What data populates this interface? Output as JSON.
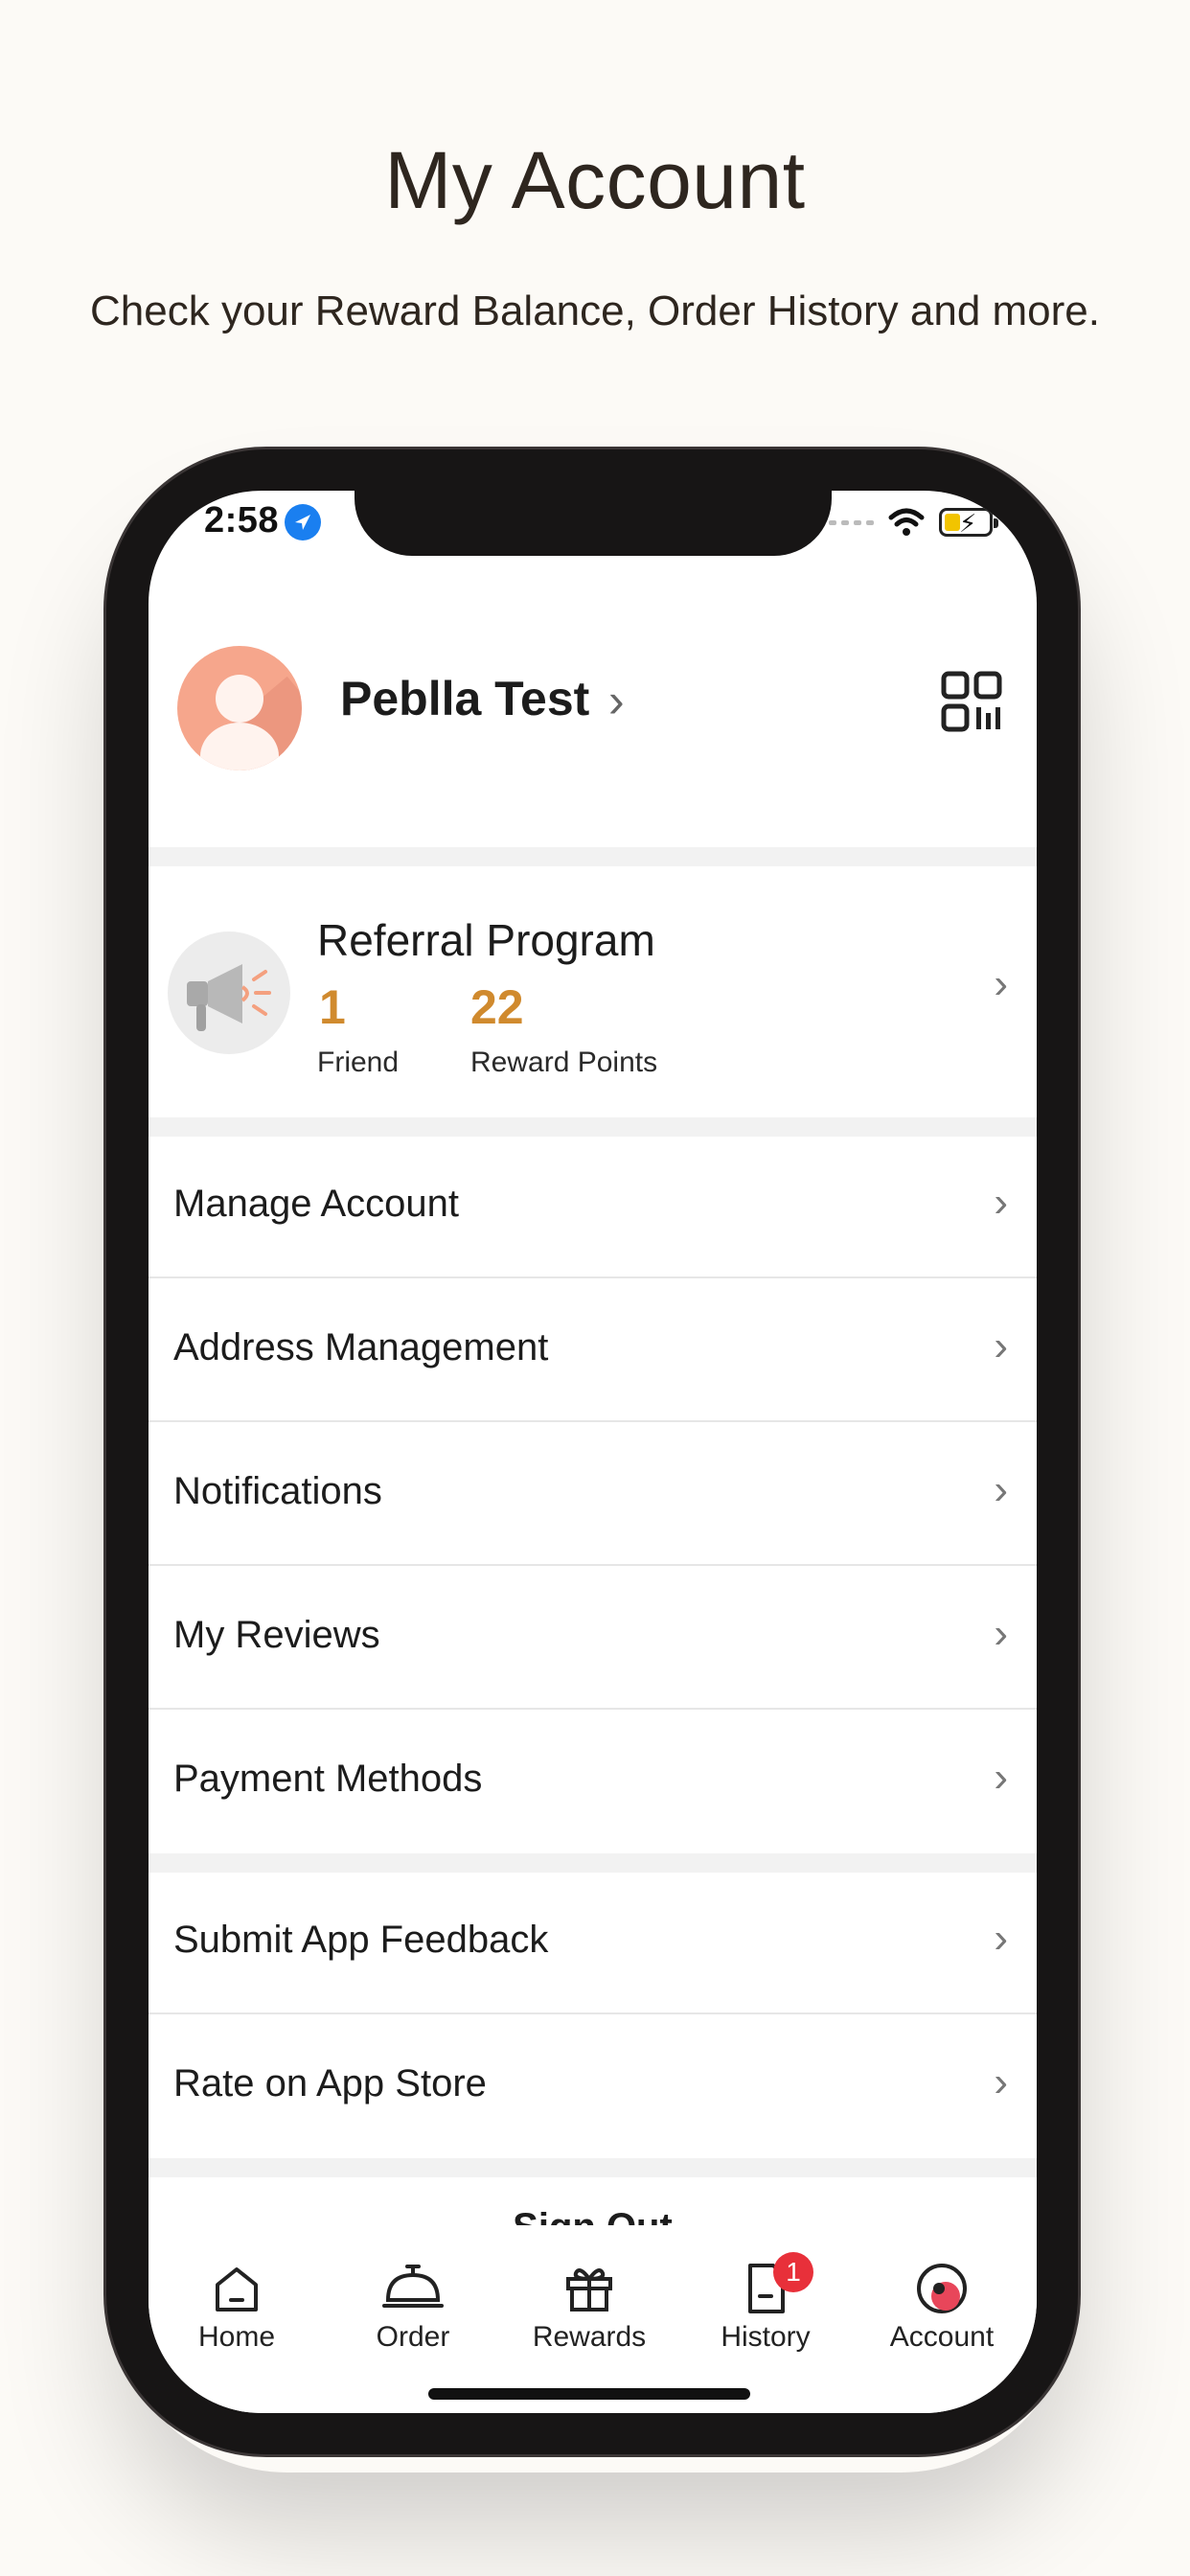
{
  "hero": {
    "title": "My Account",
    "subtitle": "Check your Reward Balance, Order History and more."
  },
  "status_bar": {
    "time": "2:58",
    "icons": [
      "location-arrow-icon",
      "signal-icon",
      "wifi-icon",
      "battery-charging-icon"
    ]
  },
  "profile": {
    "name": "Peblla Test",
    "icons": [
      "avatar-icon",
      "chevron-right-icon",
      "qr-code-icon"
    ]
  },
  "referral": {
    "title": "Referral Program",
    "friends_count": "1",
    "friends_label": "Friend",
    "points_count": "22",
    "points_label": "Reward Points",
    "icon": "megaphone-icon"
  },
  "menu": {
    "items": [
      {
        "label": "Manage Account"
      },
      {
        "label": "Address Management"
      },
      {
        "label": "Notifications"
      },
      {
        "label": "My Reviews"
      },
      {
        "label": "Payment Methods"
      },
      {
        "label": "Submit App Feedback"
      },
      {
        "label": "Rate on App Store"
      }
    ],
    "sign_out_peek": "Sign Out"
  },
  "tabbar": {
    "tabs": [
      {
        "label": "Home",
        "icon": "home-icon"
      },
      {
        "label": "Order",
        "icon": "cloche-icon"
      },
      {
        "label": "Rewards",
        "icon": "gift-icon"
      },
      {
        "label": "History",
        "icon": "document-icon",
        "badge": "1"
      },
      {
        "label": "Account",
        "icon": "account-icon"
      }
    ],
    "active": "Account"
  },
  "colors": {
    "background": "#fcfaf6",
    "accent": "#d08a2e",
    "badge": "#e8303a",
    "avatar": "#f6a68c"
  }
}
